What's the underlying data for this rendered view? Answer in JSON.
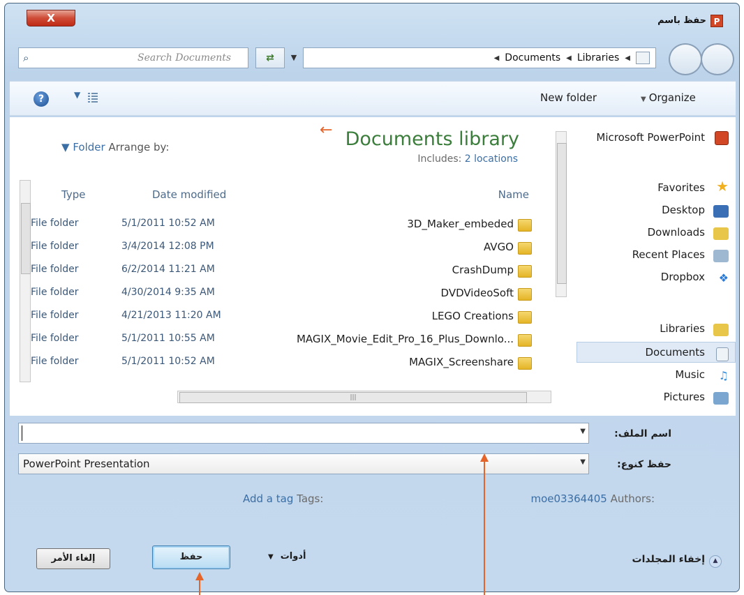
{
  "window": {
    "title": "حفظ باسم",
    "app_icon_letter": "P",
    "close_label": "X"
  },
  "search": {
    "placeholder": "Search Documents"
  },
  "address": {
    "crumbs": [
      "Documents",
      "Libraries"
    ]
  },
  "toolbar": {
    "new_folder_label": "New folder",
    "organize_label": "Organize",
    "help_label": "?"
  },
  "library": {
    "title": "Documents library",
    "includes_label": "Includes:",
    "includes_value": "2 locations",
    "arrange_by_label": "Arrange by:",
    "arrange_by_value": "Folder"
  },
  "columns": {
    "name": "Name",
    "date_modified": "Date modified",
    "type": "Type"
  },
  "files": [
    {
      "name": "3D_Maker_embeded",
      "date": "5/1/2011 10:52 AM",
      "type": "File folder"
    },
    {
      "name": "AVGO",
      "date": "3/4/2014 12:08 PM",
      "type": "File folder"
    },
    {
      "name": "CrashDump",
      "date": "6/2/2014 11:21 AM",
      "type": "File folder"
    },
    {
      "name": "DVDVideoSoft",
      "date": "4/30/2014 9:35 AM",
      "type": "File folder"
    },
    {
      "name": "LEGO Creations",
      "date": "4/21/2013 11:20 AM",
      "type": "File folder"
    },
    {
      "name": "MAGIX_Movie_Edit_Pro_16_Plus_Downlo...",
      "date": "5/1/2011 10:55 AM",
      "type": "File folder"
    },
    {
      "name": "MAGIX_Screenshare",
      "date": "5/1/2011 10:52 AM",
      "type": "File folder"
    }
  ],
  "nav_pane": {
    "app_item": "Microsoft PowerPoint",
    "favorites": "Favorites",
    "desktop": "Desktop",
    "downloads": "Downloads",
    "recent_places": "Recent Places",
    "dropbox": "Dropbox",
    "libraries": "Libraries",
    "documents": "Documents",
    "music": "Music",
    "pictures": "Pictures"
  },
  "form": {
    "filename_label": "اسم الملف:",
    "filename_value": "",
    "savetype_label": "حفظ كنوع:",
    "savetype_value": "PowerPoint Presentation",
    "authors_label": "Authors:",
    "authors_value": "moe03364405",
    "tags_label": "Tags:",
    "tags_value": "Add a tag"
  },
  "buttons": {
    "save": "حفظ",
    "cancel": "إلغاء الأمر",
    "tools": "أدوات",
    "hide_folders": "إخفاء المجلدات"
  },
  "colors": {
    "annotation_arrow": "#e5642a",
    "library_title": "#3b7d3b",
    "link": "#3a6ea5"
  }
}
